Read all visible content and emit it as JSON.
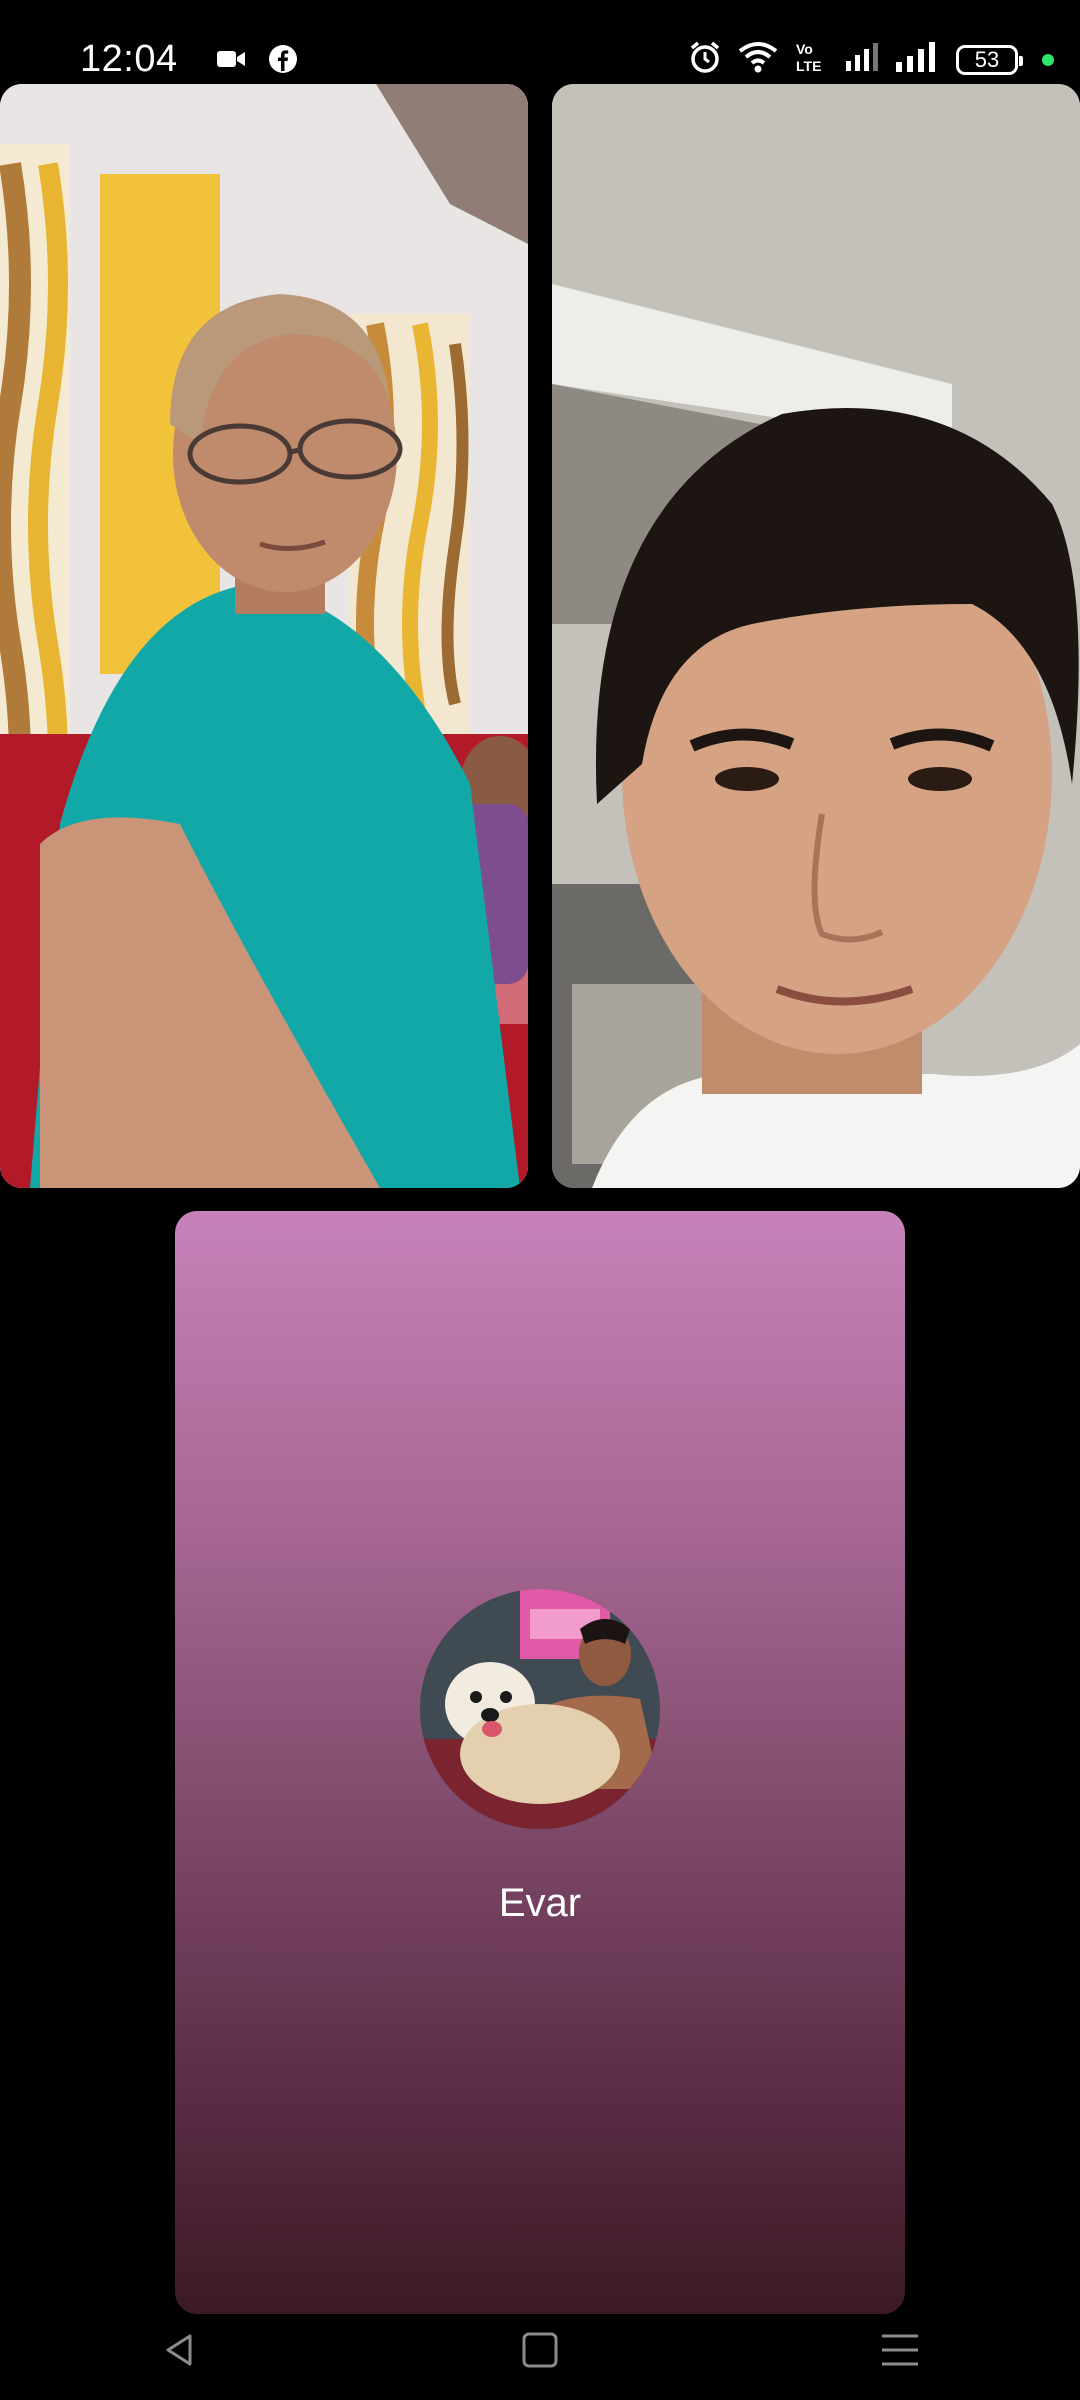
{
  "status_bar": {
    "time": "12:04",
    "left_icons": [
      "video-camera-icon",
      "facebook-icon"
    ],
    "right_icons": [
      "alarm-icon",
      "wifi-icon",
      "volte-icon",
      "signal-icon",
      "signal-icon"
    ],
    "volte_label": "Vo\nLTE",
    "battery_level": "53",
    "indicator_color": "#2ee66a"
  },
  "call": {
    "participants": [
      {
        "type": "video"
      },
      {
        "type": "video"
      },
      {
        "type": "avatar",
        "name": "Evar"
      }
    ],
    "background_gradient": [
      "#c682b9",
      "#3b1a24"
    ]
  },
  "nav_bar": {
    "buttons": [
      "back-icon",
      "home-icon",
      "recents-icon"
    ]
  }
}
